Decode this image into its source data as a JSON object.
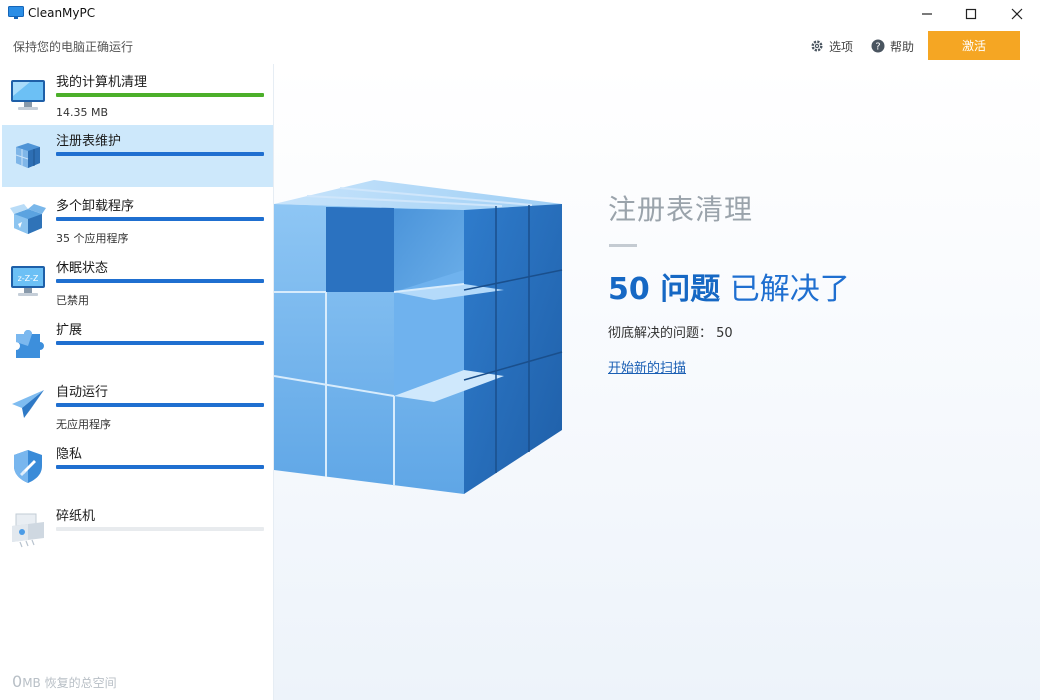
{
  "window": {
    "title": "CleanMyPC",
    "controls": {
      "minimize": "minimize-icon",
      "maximize": "maximize-icon",
      "close": "close-icon"
    }
  },
  "header": {
    "tagline": "保持您的电脑正确运行",
    "options_label": "选项",
    "help_label": "帮助",
    "activate_label": "激活"
  },
  "sidebar": {
    "items": [
      {
        "label": "我的计算机清理",
        "sub": "14.35 MB",
        "icon": "monitor-icon",
        "bar": "green"
      },
      {
        "label": "注册表维护",
        "sub": "",
        "icon": "registry-cubes-icon",
        "bar": "blue",
        "active": true
      },
      {
        "label": "多个卸载程序",
        "sub": "35 个应用程序",
        "icon": "uninstall-box-icon",
        "bar": "blue"
      },
      {
        "label": "休眠状态",
        "sub": "已禁用",
        "icon": "sleep-monitor-icon",
        "bar": "blue"
      },
      {
        "label": "扩展",
        "sub": "",
        "icon": "puzzle-icon",
        "bar": "blue"
      },
      {
        "label": "自动运行",
        "sub": "无应用程序",
        "icon": "paper-plane-icon",
        "bar": "blue"
      },
      {
        "label": "隐私",
        "sub": "",
        "icon": "shield-broom-icon",
        "bar": "blue"
      },
      {
        "label": "碎纸机",
        "sub": "",
        "icon": "shredder-icon",
        "bar": "grey"
      }
    ],
    "footer": {
      "amount": "0",
      "text": "MB 恢复的总空间"
    }
  },
  "main": {
    "title": "注册表清理",
    "count": "50 问题",
    "status": " 已解决了",
    "detail": "彻底解决的问题： 50",
    "new_scan": "开始新的扫描"
  },
  "colors": {
    "accent": "#1f6fd0",
    "activate": "#f5a623",
    "progress_green": "#4caf2a",
    "active_item_bg": "#cde8fb"
  }
}
